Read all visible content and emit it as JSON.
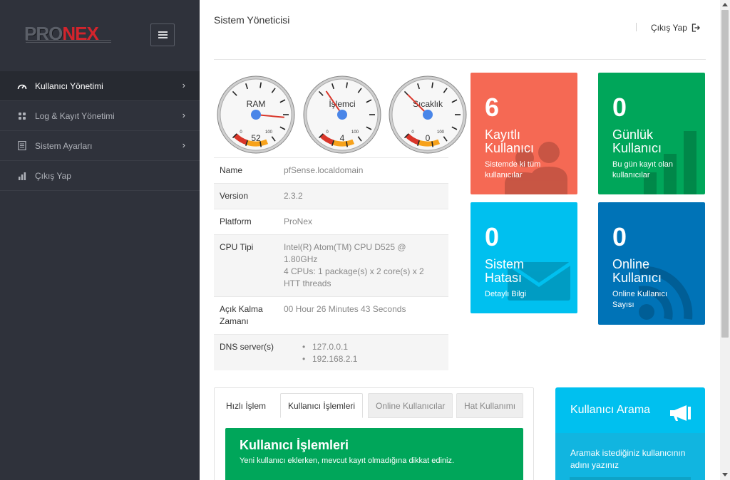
{
  "brand": {
    "logo_part1": "PRO",
    "logo_part2": "NEX"
  },
  "sidebar": {
    "items": [
      {
        "label": "Kullanıcı Yönetimi",
        "icon": "dashboard-gauge-icon",
        "active": true
      },
      {
        "label": "Log & Kayıt Yönetimi",
        "icon": "grid-icon",
        "active": false
      },
      {
        "label": "Sistem Ayarları",
        "icon": "document-icon",
        "active": false
      },
      {
        "label": "Çıkış Yap",
        "icon": "bar-chart-icon",
        "active": false
      }
    ]
  },
  "header": {
    "title": "Sistem Yöneticisi",
    "logout_label": "Çıkış Yap"
  },
  "gauges": [
    {
      "label": "RAM",
      "value": 52,
      "min": 0,
      "max": 100
    },
    {
      "label": "İşlemci",
      "value": 4,
      "min": 0,
      "max": 100
    },
    {
      "label": "Sıcaklık",
      "value": 0,
      "min": 0,
      "max": 100
    }
  ],
  "system_info": {
    "name_label": "Name",
    "name_value": "pfSense.localdomain",
    "version_label": "Version",
    "version_value": "2.3.2",
    "platform_label": "Platform",
    "platform_value": "ProNex",
    "cpu_label": "CPU Tipi",
    "cpu_value_line1": "Intel(R) Atom(TM) CPU D525 @",
    "cpu_value_line2": "1.80GHz",
    "cpu_value_line3": "4 CPUs: 1 package(s) x 2 core(s) x 2",
    "cpu_value_line4": "HTT threads",
    "uptime_label_line1": "Açık Kalma",
    "uptime_label_line2": "Zamanı",
    "uptime_value": "00 Hour 26 Minutes 43 Seconds",
    "dns_label": "DNS server(s)",
    "dns_servers": [
      "127.0.0.1",
      "192.168.2.1"
    ]
  },
  "cards": {
    "registered": {
      "count": "6",
      "title_line1": "Kayıtlı",
      "title_line2": "Kullanıcı",
      "sub_line1": "Sistemde ki tüm",
      "sub_line2": "kullanıcılar",
      "color": "#f56954"
    },
    "daily": {
      "count": "0",
      "title_line1": "Günlük",
      "title_line2": "Kullanıcı",
      "sub_line1": "Bu gün kayıt olan",
      "sub_line2": "kullanıcılar",
      "color": "#00a65a"
    },
    "errors": {
      "count": "0",
      "title_line1": "Sistem",
      "title_line2": "Hatası",
      "sub_line1": "Detaylı Bilgi",
      "color": "#00c0ef"
    },
    "online": {
      "count": "0",
      "title_line1": "Online",
      "title_line2": "Kullanıcı",
      "sub_line1": "Online Kullanıcı",
      "sub_line2": "Sayısı",
      "color": "#0073b7"
    }
  },
  "tabs": {
    "items": [
      "Hızlı İşlem",
      "Kullanıcı İşlemleri",
      "Online Kullanıcılar",
      "Hat Kullanımı"
    ],
    "panel_title": "Kullanıcı İşlemleri",
    "panel_text": "Yeni kullanıcı eklerken, mevcut kayıt olmadığına dikkat ediniz."
  },
  "search_box": {
    "title": "Kullanıcı Arama",
    "icon": "megaphone-icon",
    "text_line1": "Aramak istediğiniz kullanıcının",
    "text_line2": "adını yazınız"
  }
}
